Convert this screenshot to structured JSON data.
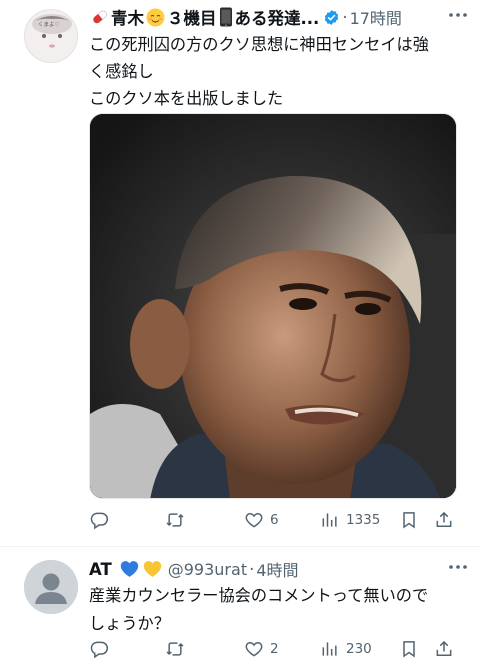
{
  "tweets": [
    {
      "name": "青木",
      "name_extra": "３機目",
      "name_tail": "ある発達...",
      "time": "17時間",
      "lines": [
        "この死刑囚の方のクソ思想に神田センセイは強",
        "く感銘し",
        "このクソ本を出版しました"
      ],
      "actions": {
        "reply_count": "",
        "retweet_count": "",
        "like_count": "6",
        "view_count": "1335"
      }
    },
    {
      "name": "AT",
      "handle": "@993urat",
      "time": "4時間",
      "lines": [
        "産業カウンセラー協会のコメントって無いので",
        "しょうか？"
      ],
      "actions": {
        "reply_count": "",
        "retweet_count": "",
        "like_count": "2",
        "view_count": "230"
      }
    }
  ],
  "icons": {
    "reply": "reply-icon",
    "retweet": "retweet-icon",
    "like": "heart-icon",
    "views": "views-icon",
    "bookmark": "bookmark-icon",
    "share": "share-icon"
  },
  "colors": {
    "text": "#0f1419",
    "secondary": "#536471",
    "verified": "#1d9bf0",
    "divider": "#eff3f4"
  }
}
